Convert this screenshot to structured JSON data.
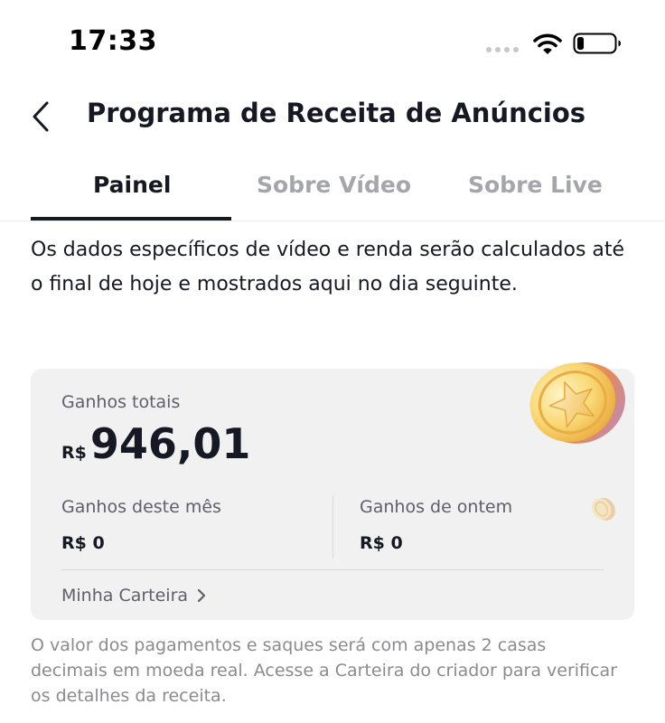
{
  "status_bar": {
    "time": "17:33",
    "icons": [
      "signal-dots-icon",
      "wifi-icon",
      "battery-icon"
    ]
  },
  "header": {
    "title": "Programa de Receita de Anúncios",
    "back_icon": "chevron-left-icon"
  },
  "tabs": [
    {
      "label": "Painel",
      "active": true
    },
    {
      "label": "Sobre Vídeo",
      "active": false
    },
    {
      "label": "Sobre Live",
      "active": false
    }
  ],
  "intro_text": "Os dados específicos de vídeo e renda serão calculados até o final de hoje e mostrados aqui no dia seguinte.",
  "earnings": {
    "total_label": "Ganhos totais",
    "currency": "R$",
    "total_amount": "946,01",
    "month_label": "Ganhos deste mês",
    "month_value": "R$ 0",
    "yesterday_label": "Ganhos de ontem",
    "yesterday_value": "R$ 0",
    "wallet_link": "Minha Carteira",
    "decor_icons": [
      "gold-coin-icon",
      "small-coin-icon"
    ]
  },
  "footer_note": "O valor dos pagamentos e saques será com apenas 2 casas decimais em moeda real. Acesse a Carteira do criador para verificar os detalhes da receita.",
  "colors": {
    "text_primary": "#161823",
    "text_secondary": "#5f6068",
    "text_muted": "#8a8b91",
    "tab_inactive": "#a5a6ab",
    "card_background": "#f1f1f2",
    "coin_gold": "#f5c443"
  }
}
